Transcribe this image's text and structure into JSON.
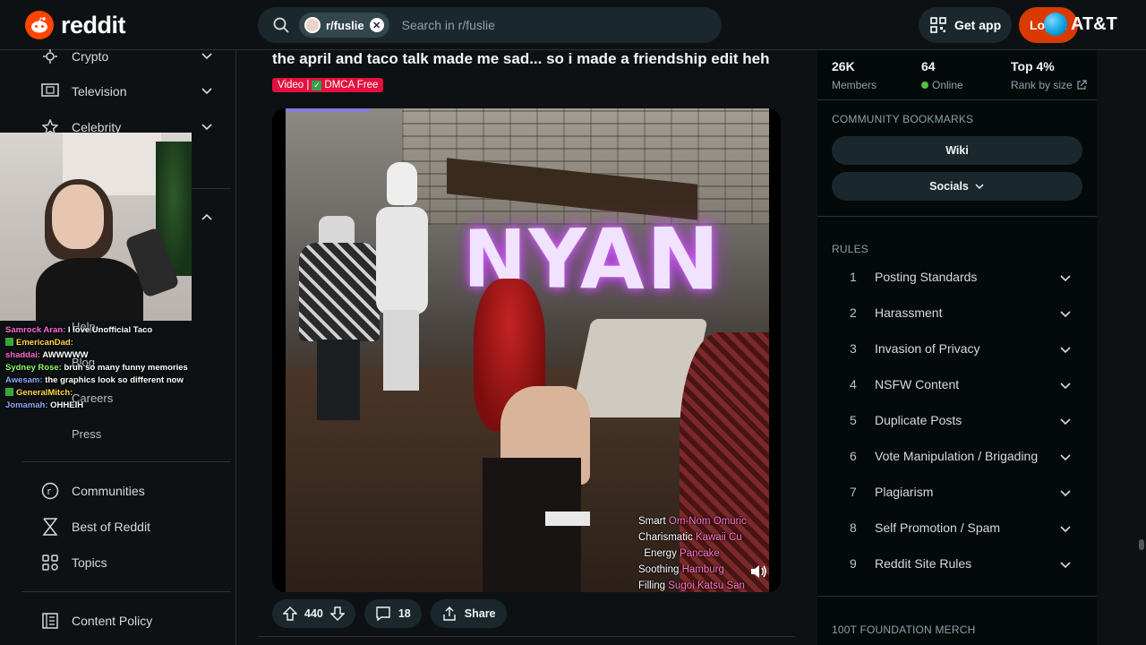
{
  "header": {
    "brand": "reddit",
    "search_chip": "r/fuslie",
    "search_placeholder": "Search in r/fuslie",
    "get_app": "Get app",
    "login": "Log In",
    "overlay_brand": "AT&T"
  },
  "sidebar": {
    "items": [
      {
        "label": "Crypto",
        "icon": "crypto-icon"
      },
      {
        "label": "Television",
        "icon": "tv-icon"
      },
      {
        "label": "Celebrity",
        "icon": "star-icon"
      }
    ],
    "resources_partial": [
      "Help",
      "Blog",
      "Careers",
      "Press"
    ],
    "bottom": [
      {
        "label": "Communities",
        "icon": "communities-icon"
      },
      {
        "label": "Best of Reddit",
        "icon": "hourglass-icon"
      },
      {
        "label": "Topics",
        "icon": "topics-icon"
      },
      {
        "label": "Content Policy",
        "icon": "policy-icon"
      }
    ]
  },
  "stream_chat": [
    {
      "user": "Samrock Aran:",
      "msg": "I love Unofficial Taco",
      "color": "#ff6ad5"
    },
    {
      "user": "EmericanDad:",
      "msg": "",
      "color": "#ffd84a"
    },
    {
      "user": "shaddai:",
      "msg": "AWWWWW",
      "color": "#ff6ad5"
    },
    {
      "user": "Sydney Rose:",
      "msg": "bruh so many funny memories",
      "color": "#8cff66"
    },
    {
      "user": "Awesam:",
      "msg": "the graphics look so different now",
      "color": "#8fa8ff"
    },
    {
      "user": "GeneralMitch:",
      "msg": "",
      "color": "#ffd84a"
    },
    {
      "user": "Jomamah:",
      "msg": "OHHEIH",
      "color": "#8fa8ff"
    }
  ],
  "post": {
    "title": "the april and taco talk made me sad... so i made a friendship edit heh",
    "flair_prefix": "Video |",
    "flair_suffix": "DMCA Free",
    "video_text": "NYAN",
    "video_stats": [
      {
        "label": "Smart",
        "value": "Om-Nom Omuric"
      },
      {
        "label": "Charismatic",
        "value": "Kawaii Cu"
      },
      {
        "label": "Energy",
        "value": "Pancake"
      },
      {
        "label": "Soothing",
        "value": "Hamburg"
      },
      {
        "label": "Filling",
        "value": "Sugoi Katsu San"
      }
    ],
    "votes": "440",
    "comments": "18",
    "share": "Share"
  },
  "community": {
    "members_count": "26K",
    "members_label": "Members",
    "online_count": "64",
    "online_label": "Online",
    "rank": "Top 4%",
    "rank_label": "Rank by size",
    "bookmarks_heading": "COMMUNITY BOOKMARKS",
    "bookmarks": [
      "Wiki",
      "Socials"
    ],
    "rules_heading": "RULES",
    "rules": [
      {
        "num": "1",
        "text": "Posting Standards"
      },
      {
        "num": "2",
        "text": "Harassment"
      },
      {
        "num": "3",
        "text": "Invasion of Privacy"
      },
      {
        "num": "4",
        "text": "NSFW Content"
      },
      {
        "num": "5",
        "text": "Duplicate Posts"
      },
      {
        "num": "6",
        "text": "Vote Manipulation / Brigading"
      },
      {
        "num": "7",
        "text": "Plagiarism"
      },
      {
        "num": "8",
        "text": "Self Promotion / Spam"
      },
      {
        "num": "9",
        "text": "Reddit Site Rules"
      }
    ],
    "next_heading": "100T FOUNDATION MERCH"
  },
  "colors": {
    "accent": "#ff4500",
    "login": "#d93a00",
    "flair": "#e3113d",
    "online": "#55bd46"
  }
}
